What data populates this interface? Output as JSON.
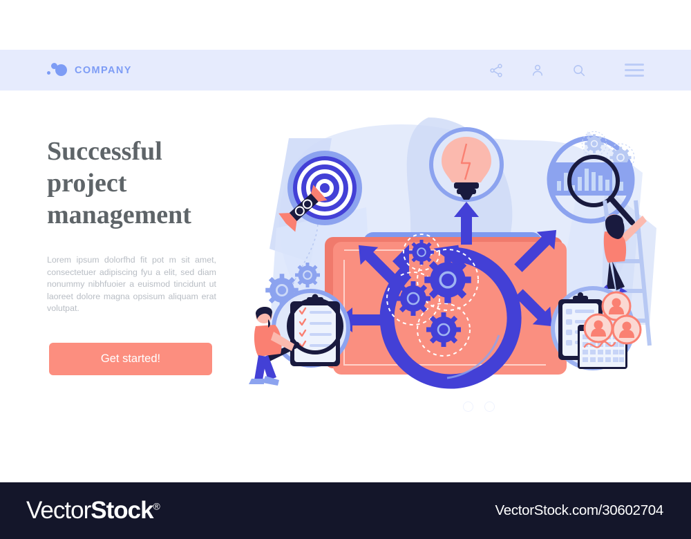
{
  "header": {
    "brand_name": "COMPANY",
    "brand_icon": "bubbles-logo-icon",
    "icons": [
      {
        "name": "share-icon",
        "label": "Share"
      },
      {
        "name": "user-account-icon",
        "label": "Account"
      },
      {
        "name": "search-icon",
        "label": "Search"
      }
    ],
    "menu_icon": "hamburger-menu-icon",
    "background_color": "#e6ebfd",
    "accent_color": "#7d9cf5"
  },
  "hero": {
    "title": "Successful project management",
    "title_lines": [
      "Successful",
      "project",
      "management"
    ],
    "paragraph": "Lorem ipsum dolorfhd fit pot m sit amet, consectetuer adipiscing fyu  a elit, sed diam nonummy nibhfuoier a euismod tincidunt ut laoreet dolore magna opsisum aliquam erat volutpat.",
    "cta_label": "Get started!",
    "cta_color": "#fc8e7f",
    "title_color": "#5e6468",
    "paragraph_color": "#b8bdc4"
  },
  "carousel": {
    "dots": [
      "slide-1",
      "slide-2"
    ],
    "active_index": 0
  },
  "illustration": {
    "alt": "Project management concept illustration",
    "elements": [
      "target-with-rocket-icon",
      "lightbulb-idea-icon",
      "bar-chart-with-magnifier-icon",
      "gears-cycle-arrows-icon",
      "clipboard-checklist-icon",
      "calendar-icon",
      "team-avatars-icon",
      "businesswoman-on-ladder-character",
      "businessman-with-magnifier-character"
    ],
    "colors": {
      "coral": "#fa8072",
      "coral_light": "#fe9d8f",
      "blue": "#4340d6",
      "blue_mid": "#8ca3ef",
      "blue_pale": "#c7d4f7",
      "blue_faint": "#e3eafb",
      "navy": "#191a3e",
      "white": "#ffffff"
    }
  },
  "watermark": {
    "logo_part1": "Vector",
    "logo_part2": "Stock",
    "logo_registered": "®",
    "url": "VectorStock.com/30602704",
    "background_color": "#14162a"
  }
}
